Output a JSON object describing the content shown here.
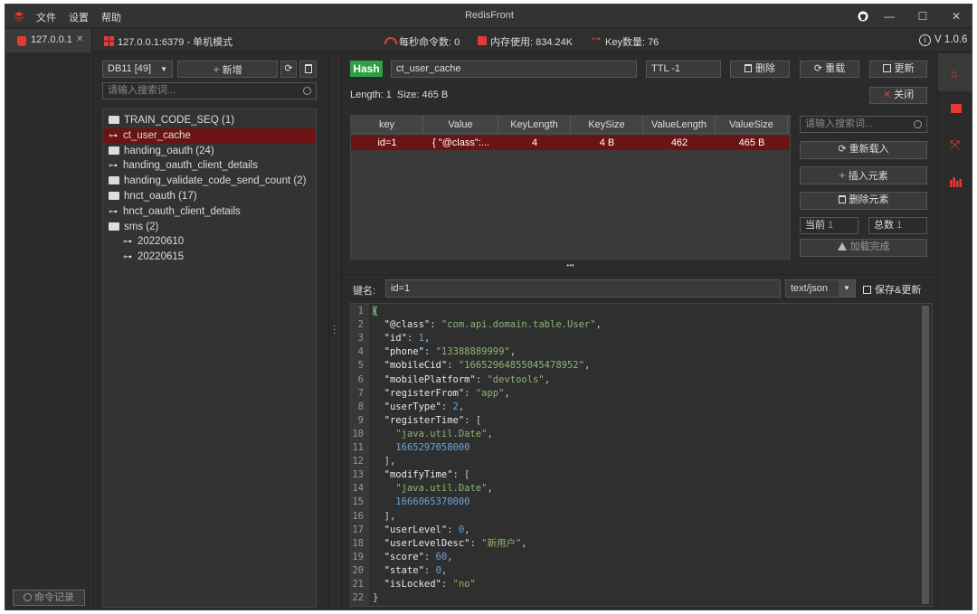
{
  "app": {
    "title": "RedisFront",
    "version": "V 1.0.6",
    "menu": [
      "文件",
      "设置",
      "帮助"
    ]
  },
  "window_controls": {
    "minimize": "—",
    "maximize": "☐",
    "close": "✕"
  },
  "tabs": [
    {
      "label": "127.0.0.1",
      "close": "✕"
    }
  ],
  "connection": {
    "label": "127.0.0.1:6379 - 单机模式",
    "ops_label": "每秒命令数: 0",
    "memory_label": "内存使用: 834.24K",
    "keys_label": "Key数量: 76"
  },
  "sidebar_left": {
    "history_button": "命令记录"
  },
  "keys_panel": {
    "db_select": "DB11 [49]",
    "add_button": "新增",
    "search_placeholder": "请输入搜索词...",
    "tree": [
      {
        "type": "folder",
        "label": "TRAIN_CODE_SEQ (1)",
        "level": 0
      },
      {
        "type": "key",
        "label": "ct_user_cache",
        "level": 0,
        "selected": true
      },
      {
        "type": "folder",
        "label": "handing_oauth (24)",
        "level": 0
      },
      {
        "type": "key",
        "label": "handing_oauth_client_details",
        "level": 0
      },
      {
        "type": "folder",
        "label": "handing_validate_code_send_count (2)",
        "level": 0
      },
      {
        "type": "folder",
        "label": "hnct_oauth (17)",
        "level": 0
      },
      {
        "type": "key",
        "label": "hnct_oauth_client_details",
        "level": 0
      },
      {
        "type": "open-folder",
        "label": "sms (2)",
        "level": 0
      },
      {
        "type": "key",
        "label": "20220610",
        "level": 1
      },
      {
        "type": "key",
        "label": "20220615",
        "level": 1
      }
    ]
  },
  "detail": {
    "type_badge": "Hash",
    "key_name": "ct_user_cache",
    "ttl_label": "TTL",
    "ttl_value": "-1",
    "delete_button": "删除",
    "reload_button": "重载",
    "update_button": "更新",
    "close_button": "关闭",
    "length_text": "Length: 1",
    "size_text": "Size: 465 B",
    "table": {
      "columns": [
        "key",
        "Value",
        "KeyLength",
        "KeySize",
        "ValueLength",
        "ValueSize"
      ],
      "rows": [
        [
          "id=1",
          "{ \"@class\":...",
          "4",
          "4 B",
          "462",
          "465 B"
        ]
      ]
    },
    "side_search_placeholder": "请输入搜索词...",
    "reload_items_button": "重新载入",
    "insert_button": "插入元素",
    "delete_items_button": "删除元素",
    "current_label": "当前",
    "current_value": "1",
    "total_label": "总数",
    "total_value": "1",
    "load_done": "加载完成",
    "splitter_dots": "•••",
    "field_label": "键名:",
    "field_value": "id=1",
    "format_select": "text/json",
    "save_button": "保存&更新"
  },
  "editor": {
    "lines": [
      [
        [
          "p",
          "{"
        ]
      ],
      [
        [
          "p",
          "  "
        ],
        [
          "k",
          "\"@class\""
        ],
        [
          "p",
          ": "
        ],
        [
          "s",
          "\"com.api.domain.table.User\""
        ],
        [
          "p",
          ","
        ]
      ],
      [
        [
          "p",
          "  "
        ],
        [
          "k",
          "\"id\""
        ],
        [
          "p",
          ": "
        ],
        [
          "n",
          "1"
        ],
        [
          "p",
          ","
        ]
      ],
      [
        [
          "p",
          "  "
        ],
        [
          "k",
          "\"phone\""
        ],
        [
          "p",
          ": "
        ],
        [
          "s",
          "\"13388889999\""
        ],
        [
          "p",
          ","
        ]
      ],
      [
        [
          "p",
          "  "
        ],
        [
          "k",
          "\"mobileCid\""
        ],
        [
          "p",
          ": "
        ],
        [
          "s",
          "\"16652964855045478952\""
        ],
        [
          "p",
          ","
        ]
      ],
      [
        [
          "p",
          "  "
        ],
        [
          "k",
          "\"mobilePlatform\""
        ],
        [
          "p",
          ": "
        ],
        [
          "s",
          "\"devtools\""
        ],
        [
          "p",
          ","
        ]
      ],
      [
        [
          "p",
          "  "
        ],
        [
          "k",
          "\"registerFrom\""
        ],
        [
          "p",
          ": "
        ],
        [
          "s",
          "\"app\""
        ],
        [
          "p",
          ","
        ]
      ],
      [
        [
          "p",
          "  "
        ],
        [
          "k",
          "\"userType\""
        ],
        [
          "p",
          ": "
        ],
        [
          "n",
          "2"
        ],
        [
          "p",
          ","
        ]
      ],
      [
        [
          "p",
          "  "
        ],
        [
          "k",
          "\"registerTime\""
        ],
        [
          "p",
          ": ["
        ]
      ],
      [
        [
          "p",
          "    "
        ],
        [
          "s",
          "\"java.util.Date\""
        ],
        [
          "p",
          ","
        ]
      ],
      [
        [
          "p",
          "    "
        ],
        [
          "n",
          "1665297058000"
        ]
      ],
      [
        [
          "p",
          "  ],"
        ]
      ],
      [
        [
          "p",
          "  "
        ],
        [
          "k",
          "\"modifyTime\""
        ],
        [
          "p",
          ": ["
        ]
      ],
      [
        [
          "p",
          "    "
        ],
        [
          "s",
          "\"java.util.Date\""
        ],
        [
          "p",
          ","
        ]
      ],
      [
        [
          "p",
          "    "
        ],
        [
          "n",
          "1666065370000"
        ]
      ],
      [
        [
          "p",
          "  ],"
        ]
      ],
      [
        [
          "p",
          "  "
        ],
        [
          "k",
          "\"userLevel\""
        ],
        [
          "p",
          ": "
        ],
        [
          "n",
          "0"
        ],
        [
          "p",
          ","
        ]
      ],
      [
        [
          "p",
          "  "
        ],
        [
          "k",
          "\"userLevelDesc\""
        ],
        [
          "p",
          ": "
        ],
        [
          "s",
          "\"新用户\""
        ],
        [
          "p",
          ","
        ]
      ],
      [
        [
          "p",
          "  "
        ],
        [
          "k",
          "\"score\""
        ],
        [
          "p",
          ": "
        ],
        [
          "n",
          "60"
        ],
        [
          "p",
          ","
        ]
      ],
      [
        [
          "p",
          "  "
        ],
        [
          "k",
          "\"state\""
        ],
        [
          "p",
          ": "
        ],
        [
          "n",
          "0"
        ],
        [
          "p",
          ","
        ]
      ],
      [
        [
          "p",
          "  "
        ],
        [
          "k",
          "\"isLocked\""
        ],
        [
          "p",
          ": "
        ],
        [
          "s",
          "\"no\""
        ]
      ],
      [
        [
          "p",
          "}"
        ]
      ]
    ]
  },
  "colors": {
    "accent_red": "#e53935",
    "selection": "#6b1414",
    "badge_green": "#2ea043"
  }
}
